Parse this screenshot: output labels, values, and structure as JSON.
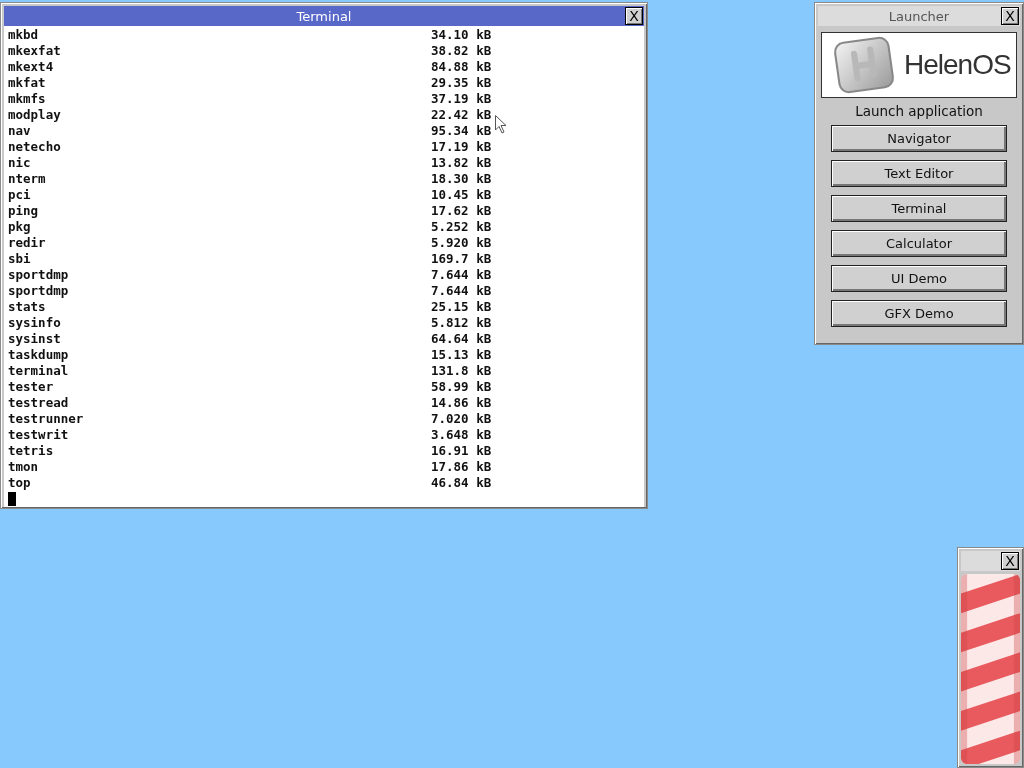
{
  "terminal": {
    "title": "Terminal",
    "close": "X",
    "lines": [
      {
        "name": "mkbd",
        "size": "34.10 kB"
      },
      {
        "name": "mkexfat",
        "size": "38.82 kB"
      },
      {
        "name": "mkext4",
        "size": "84.88 kB"
      },
      {
        "name": "mkfat",
        "size": "29.35 kB"
      },
      {
        "name": "mkmfs",
        "size": "37.19 kB"
      },
      {
        "name": "modplay",
        "size": "22.42 kB"
      },
      {
        "name": "nav",
        "size": "95.34 kB"
      },
      {
        "name": "netecho",
        "size": "17.19 kB"
      },
      {
        "name": "nic",
        "size": "13.82 kB"
      },
      {
        "name": "nterm",
        "size": "18.30 kB"
      },
      {
        "name": "pci",
        "size": "10.45 kB"
      },
      {
        "name": "ping",
        "size": "17.62 kB"
      },
      {
        "name": "pkg",
        "size": "5.252 kB"
      },
      {
        "name": "redir",
        "size": "5.920 kB"
      },
      {
        "name": "sbi",
        "size": "169.7 kB"
      },
      {
        "name": "sportdmp",
        "size": "7.644 kB"
      },
      {
        "name": "sportdmp",
        "size": "7.644 kB"
      },
      {
        "name": "stats",
        "size": "25.15 kB"
      },
      {
        "name": "sysinfo",
        "size": "5.812 kB"
      },
      {
        "name": "sysinst",
        "size": "64.64 kB"
      },
      {
        "name": "taskdump",
        "size": "15.13 kB"
      },
      {
        "name": "terminal",
        "size": "131.8 kB"
      },
      {
        "name": "tester",
        "size": "58.99 kB"
      },
      {
        "name": "testread",
        "size": "14.86 kB"
      },
      {
        "name": "testrunner",
        "size": "7.020 kB"
      },
      {
        "name": "testwrit",
        "size": "3.648 kB"
      },
      {
        "name": "tetris",
        "size": "16.91 kB"
      },
      {
        "name": "tmon",
        "size": "17.86 kB"
      },
      {
        "name": "top",
        "size": "46.84 kB"
      }
    ]
  },
  "launcher": {
    "title": "Launcher",
    "close": "X",
    "logo_text": "HelenOS",
    "heading": "Launch application",
    "buttons": [
      "Navigator",
      "Text Editor",
      "Terminal",
      "Calculator",
      "UI Demo",
      "GFX Demo"
    ]
  },
  "barber": {
    "close": "X"
  }
}
